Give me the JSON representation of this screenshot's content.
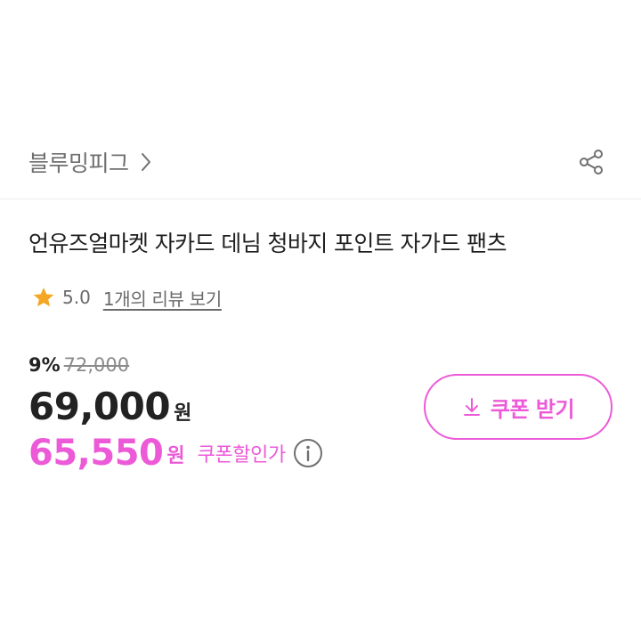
{
  "brand": {
    "name": "블루밍피그"
  },
  "product": {
    "title": "언유즈얼마켓 자카드 데님 청바지 포인트 자가드 팬츠"
  },
  "rating": {
    "score": "5.0",
    "review_link": "1개의 리뷰 보기"
  },
  "price": {
    "discount_rate": "9%",
    "original": "72,000",
    "sale": "69,000",
    "sale_unit": "원",
    "coupon_price": "65,550",
    "coupon_unit": "원",
    "coupon_label": "쿠폰할인가"
  },
  "coupon_button": {
    "label": "쿠폰 받기"
  },
  "colors": {
    "accent": "#ec5ad8",
    "star": "#f5a623",
    "text": "#222222",
    "muted": "#6f6f6f"
  },
  "icons": [
    "chevron-right-icon",
    "share-icon",
    "star-icon",
    "info-icon",
    "download-icon"
  ]
}
